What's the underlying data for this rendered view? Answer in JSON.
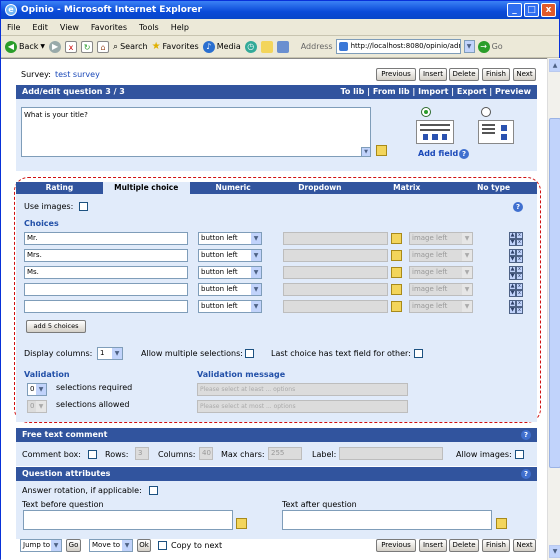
{
  "window": {
    "title": "Opinio - Microsoft Internet Explorer",
    "minimize": "_",
    "maximize": "□",
    "close": "x"
  },
  "menu": [
    "File",
    "Edit",
    "View",
    "Favorites",
    "Tools",
    "Help"
  ],
  "toolbar": {
    "back": "Back",
    "search": "Search",
    "favorites": "Favorites",
    "media": "Media",
    "address_label": "Address",
    "url": "http://localhost:8080/opinio/adm",
    "go": "Go"
  },
  "survey": {
    "label": "Survey:",
    "name": "test survey"
  },
  "nav_buttons": [
    "Previous",
    "Insert",
    "Delete",
    "Finish",
    "Next"
  ],
  "question_header": {
    "title": "Add/edit question 3 / 3",
    "links": "To lib | From lib | Import | Export | Preview"
  },
  "question_text": "What is your title?",
  "add_field": "Add field",
  "tabs": [
    "Rating",
    "Multiple choice",
    "Numeric",
    "Dropdown",
    "Matrix",
    "No type"
  ],
  "use_images": "Use images:",
  "choices_label": "Choices",
  "choices": [
    {
      "value": "Mr.",
      "button": "button left",
      "image_pos": "image left"
    },
    {
      "value": "Mrs.",
      "button": "button left",
      "image_pos": "image left"
    },
    {
      "value": "Ms.",
      "button": "button left",
      "image_pos": "image left"
    },
    {
      "value": "",
      "button": "button left",
      "image_pos": "image left"
    },
    {
      "value": "",
      "button": "button left",
      "image_pos": "image left"
    }
  ],
  "add_choices": "add 5 choices",
  "display_columns": {
    "label": "Display columns:",
    "value": "1"
  },
  "allow_multiple": "Allow multiple selections:",
  "last_choice_text": "Last choice has text field for other:",
  "validation": {
    "title": "Validation",
    "required_value": "0",
    "required_label": "selections required",
    "allowed_value": "0",
    "allowed_label": "selections allowed"
  },
  "validation_message": {
    "title": "Validation message",
    "min_placeholder": "Please select at least ... options",
    "max_placeholder": "Please select at most ... options"
  },
  "free_text": {
    "title": "Free text comment",
    "comment_box": "Comment box:",
    "rows_label": "Rows:",
    "rows": "3",
    "columns_label": "Columns:",
    "columns": "40",
    "max_chars_label": "Max chars:",
    "max_chars": "255",
    "label_label": "Label:",
    "allow_images": "Allow images:"
  },
  "question_attributes": {
    "title": "Question attributes",
    "answer_rotation": "Answer rotation, if applicable:",
    "text_before": "Text before question",
    "text_after": "Text after question"
  },
  "footer": {
    "jump_to": "Jump to",
    "go": "Go",
    "move_to": "Move to",
    "ok": "Ok",
    "copy_to_next": "Copy to next"
  }
}
